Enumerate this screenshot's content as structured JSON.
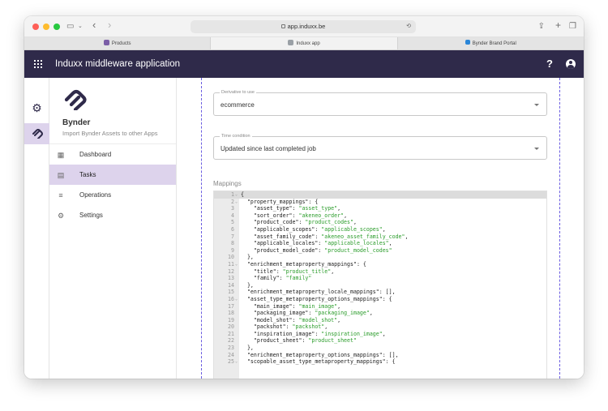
{
  "browser": {
    "url": "app.induxx.be",
    "tabs": [
      {
        "label": "Products",
        "icon": "products-favicon-icon",
        "active": false
      },
      {
        "label": "Induxx app",
        "icon": "induxx-favicon-icon",
        "active": true
      },
      {
        "label": "Bynder Brand Portal",
        "icon": "bynder-favicon-icon",
        "active": false
      }
    ]
  },
  "appbar": {
    "title": "Induxx middleware application",
    "help": "?"
  },
  "sidebar": {
    "brand_name": "Bynder",
    "brand_subtitle": "Import Bynder Assets to other Apps",
    "items": [
      {
        "label": "Dashboard",
        "icon": "dashboard-icon",
        "glyph": "▦",
        "active": false
      },
      {
        "label": "Tasks",
        "icon": "tasks-icon",
        "glyph": "▤",
        "active": true
      },
      {
        "label": "Operations",
        "icon": "operations-icon",
        "glyph": "≡",
        "active": false
      },
      {
        "label": "Settings",
        "icon": "settings-icon",
        "glyph": "⚙",
        "active": false
      }
    ]
  },
  "form": {
    "derivative": {
      "label": "Derivative to use",
      "value": "ecommerce"
    },
    "time_condition": {
      "label": "Time condition",
      "value": "Updated since last completed job"
    },
    "mappings_label": "Mappings"
  },
  "code_lines": [
    {
      "n": "1",
      "fold": true,
      "indent": "",
      "key": "",
      "val": "",
      "tail": "{"
    },
    {
      "n": "2",
      "fold": true,
      "indent": "  ",
      "key": "\"property_mappings\"",
      "val": "",
      "tail": ": {"
    },
    {
      "n": "3",
      "fold": false,
      "indent": "    ",
      "key": "\"asset_type\"",
      "val": "\"asset_type\"",
      "tail": ","
    },
    {
      "n": "4",
      "fold": false,
      "indent": "    ",
      "key": "\"sort_order\"",
      "val": "\"akeneo_order\"",
      "tail": ","
    },
    {
      "n": "5",
      "fold": false,
      "indent": "    ",
      "key": "\"product_code\"",
      "val": "\"product_codes\"",
      "tail": ","
    },
    {
      "n": "6",
      "fold": false,
      "indent": "    ",
      "key": "\"applicable_scopes\"",
      "val": "\"applicable_scopes\"",
      "tail": ","
    },
    {
      "n": "7",
      "fold": false,
      "indent": "    ",
      "key": "\"asset_family_code\"",
      "val": "\"akeneo_asset_family_code\"",
      "tail": ","
    },
    {
      "n": "8",
      "fold": false,
      "indent": "    ",
      "key": "\"applicable_locales\"",
      "val": "\"applicable_locales\"",
      "tail": ","
    },
    {
      "n": "9",
      "fold": false,
      "indent": "    ",
      "key": "\"product_model_code\"",
      "val": "\"product_model_codes\"",
      "tail": ""
    },
    {
      "n": "10",
      "fold": false,
      "indent": "  ",
      "key": "",
      "val": "",
      "tail": "},"
    },
    {
      "n": "11",
      "fold": true,
      "indent": "  ",
      "key": "\"enrichment_metaproperty_mappings\"",
      "val": "",
      "tail": ": {"
    },
    {
      "n": "12",
      "fold": false,
      "indent": "    ",
      "key": "\"title\"",
      "val": "\"product_title\"",
      "tail": ","
    },
    {
      "n": "13",
      "fold": false,
      "indent": "    ",
      "key": "\"family\"",
      "val": "\"family\"",
      "tail": ""
    },
    {
      "n": "14",
      "fold": false,
      "indent": "  ",
      "key": "",
      "val": "",
      "tail": "},"
    },
    {
      "n": "15",
      "fold": false,
      "indent": "  ",
      "key": "\"enrichment_metaproperty_locale_mappings\"",
      "val": "",
      "tail": ": [],"
    },
    {
      "n": "16",
      "fold": true,
      "indent": "  ",
      "key": "\"asset_type_metaproperty_options_mappings\"",
      "val": "",
      "tail": ": {"
    },
    {
      "n": "17",
      "fold": false,
      "indent": "    ",
      "key": "\"main_image\"",
      "val": "\"main_image\"",
      "tail": ","
    },
    {
      "n": "18",
      "fold": false,
      "indent": "    ",
      "key": "\"packaging_image\"",
      "val": "\"packaging_image\"",
      "tail": ","
    },
    {
      "n": "19",
      "fold": false,
      "indent": "    ",
      "key": "\"model_shot\"",
      "val": "\"model_shot\"",
      "tail": ","
    },
    {
      "n": "20",
      "fold": false,
      "indent": "    ",
      "key": "\"packshot\"",
      "val": "\"packshot\"",
      "tail": ","
    },
    {
      "n": "21",
      "fold": false,
      "indent": "    ",
      "key": "\"inspiration_image\"",
      "val": "\"inspiration_image\"",
      "tail": ","
    },
    {
      "n": "22",
      "fold": false,
      "indent": "    ",
      "key": "\"product_sheet\"",
      "val": "\"product_sheet\"",
      "tail": ""
    },
    {
      "n": "23",
      "fold": false,
      "indent": "  ",
      "key": "",
      "val": "",
      "tail": "},"
    },
    {
      "n": "24",
      "fold": false,
      "indent": "  ",
      "key": "\"enrichment_metaproperty_options_mappings\"",
      "val": "",
      "tail": ": [],"
    },
    {
      "n": "25",
      "fold": true,
      "indent": "  ",
      "key": "\"scopable_asset_type_metaproperty_mappings\"",
      "val": "",
      "tail": ": {"
    }
  ]
}
